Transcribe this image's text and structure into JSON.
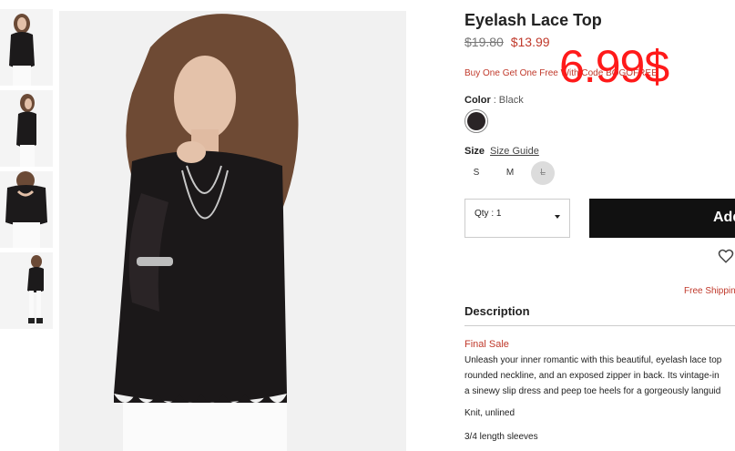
{
  "product": {
    "title": "Eyelash Lace Top",
    "old_price": "$19.80",
    "new_price": "$13.99",
    "promo": "Buy One Get One Free With Code BOGOFREE",
    "overlay_price": "6.99$"
  },
  "color": {
    "label": "Color",
    "separator": ":",
    "value": "Black",
    "swatch_hex": "#2a2426"
  },
  "size": {
    "label": "Size",
    "guide": "Size Guide",
    "options": [
      "S",
      "M",
      "L"
    ],
    "unavailable": "L"
  },
  "quantity": {
    "label": "Qty : 1"
  },
  "cart": {
    "add_label": "Add"
  },
  "shipping": {
    "note": "Free Shipping"
  },
  "description": {
    "heading": "Description",
    "final_sale": "Final Sale",
    "lines": [
      "Unleash your inner romantic with this beautiful, eyelash lace top",
      "rounded neckline, and an exposed zipper in back. Its vintage-in",
      "a sinewy slip dress and peep toe heels for a gorgeously languid"
    ],
    "features": [
      "Knit, unlined",
      "3/4 length sleeves"
    ]
  },
  "colors": {
    "sale_red": "#c0392b",
    "overlay_red": "#ff1a1a",
    "button_black": "#111111"
  }
}
